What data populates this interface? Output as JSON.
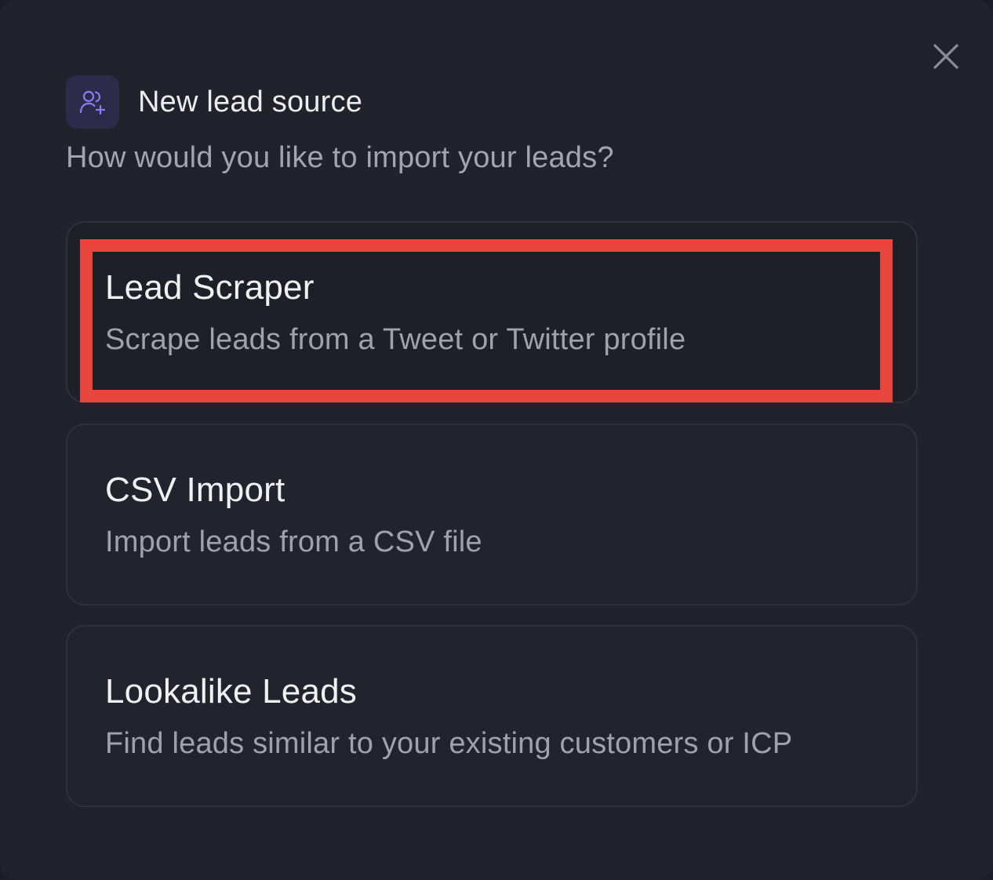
{
  "dialog": {
    "title": "New lead source",
    "subtitle": "How would you like to import your leads?",
    "header_icon": "users-plus-icon",
    "close_icon": "close-icon"
  },
  "options": [
    {
      "title": "Lead Scraper",
      "description": "Scrape leads from a Tweet or Twitter profile",
      "highlighted": true
    },
    {
      "title": "CSV Import",
      "description": "Import leads from a CSV file",
      "highlighted": false
    },
    {
      "title": "Lookalike Leads",
      "description": "Find leads similar to your existing customers or ICP",
      "highlighted": false
    }
  ],
  "colors": {
    "background": "#21222c",
    "accent": "#7b6cf0",
    "highlight_border": "#e8453c"
  }
}
